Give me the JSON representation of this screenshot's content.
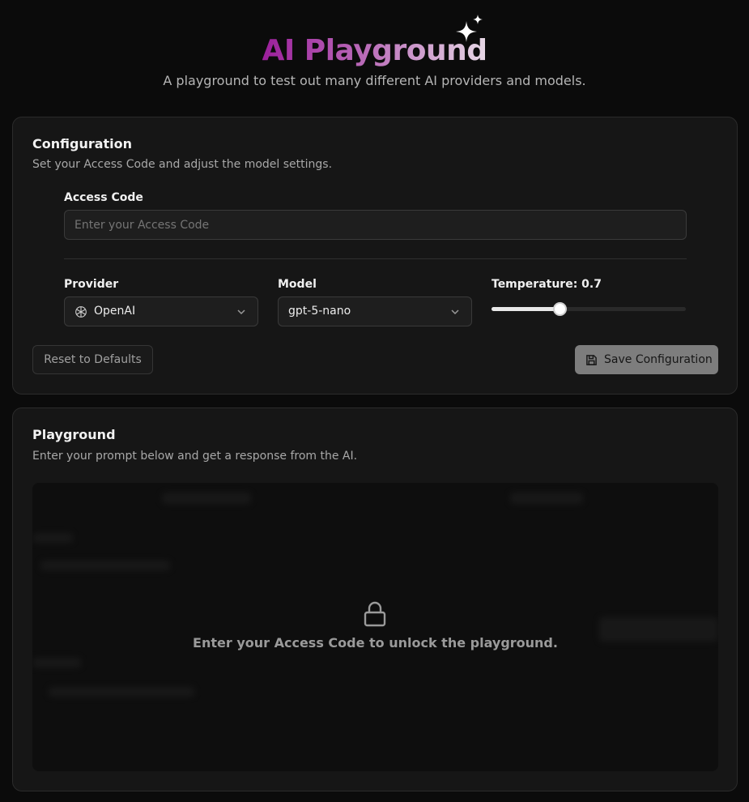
{
  "header": {
    "title": "AI Playground",
    "subtitle": "A playground to test out many different AI providers and models."
  },
  "config": {
    "title": "Configuration",
    "description": "Set your Access Code and adjust the model settings.",
    "access_code": {
      "label": "Access Code",
      "placeholder": "Enter your Access Code",
      "value": ""
    },
    "provider": {
      "label": "Provider",
      "value": "OpenAI",
      "icon": "openai-icon"
    },
    "model": {
      "label": "Model",
      "value": "gpt-5-nano"
    },
    "temperature": {
      "label": "Temperature: 0.7",
      "value": 0.7,
      "min": 0,
      "max": 2
    },
    "reset_label": "Reset to Defaults",
    "save_label": "Save Configuration"
  },
  "playground": {
    "title": "Playground",
    "description": "Enter your prompt below and get a response from the AI.",
    "locked_message": "Enter your Access Code to unlock the playground."
  },
  "colors": {
    "background": "#0b0b0b",
    "card": "#161616",
    "title_gradient_start": "#9b1f9b",
    "title_gradient_end": "#e7d8e6",
    "save_button": "#7d7d7d"
  }
}
